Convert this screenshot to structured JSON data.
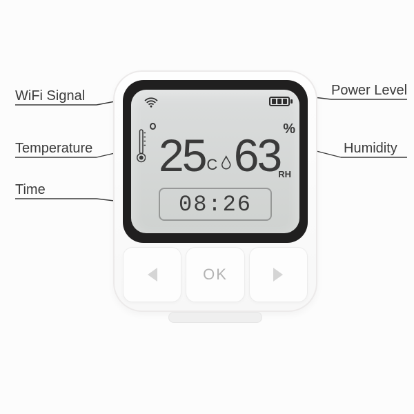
{
  "labels": {
    "wifi": "WiFi Signal",
    "power": "Power Level",
    "temp": "Temperature",
    "hum": "Humidity",
    "time": "Time"
  },
  "display": {
    "temperature_value": "25",
    "temperature_unit": "C",
    "humidity_value": "63",
    "humidity_pct": "%",
    "humidity_rh": "RH",
    "time_value": "08:26"
  },
  "buttons": {
    "ok": "OK"
  },
  "icons": {
    "wifi": "wifi-icon",
    "battery": "battery-icon",
    "thermometer": "thermometer-icon",
    "droplet": "droplet-icon"
  }
}
